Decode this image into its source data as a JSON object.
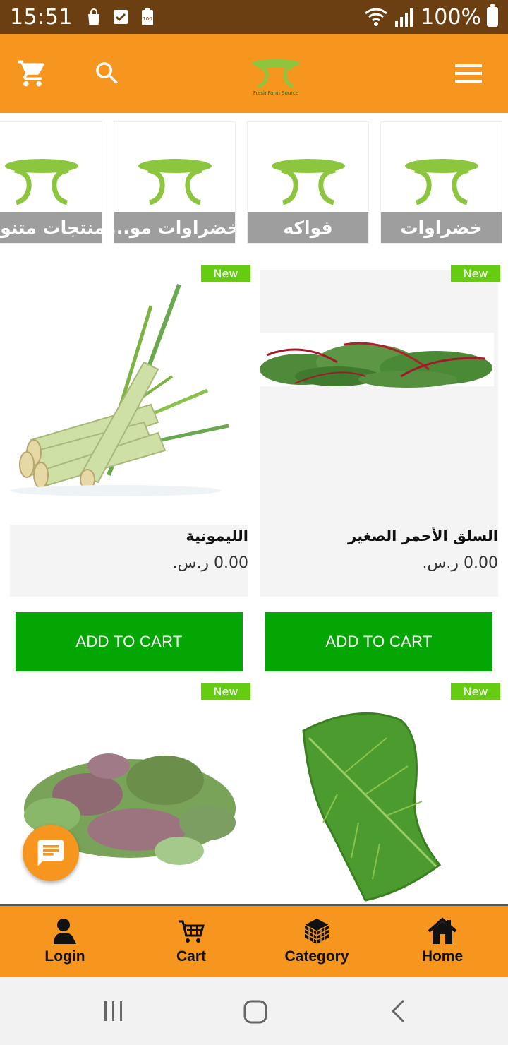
{
  "status_bar": {
    "time": "15:51",
    "battery": "100%"
  },
  "header": {
    "icons": [
      "cart-icon",
      "search-icon",
      "menu-icon"
    ],
    "logo_text": "Fresh Farm Source"
  },
  "categories": [
    {
      "label": "خضراوات"
    },
    {
      "label": "فواكه"
    },
    {
      "label": "خضراوات مو..."
    },
    {
      "label": "منتجات متنوعة"
    }
  ],
  "products": [
    {
      "badge": "New",
      "name": "السلق الأحمر الصغير",
      "price": "0.00 ر.س.",
      "button": "ADD TO CART"
    },
    {
      "badge": "New",
      "name": "الليمونية",
      "price": "0.00 ر.س.",
      "button": "ADD TO CART"
    },
    {
      "badge": "New",
      "name": "",
      "price": "",
      "button": ""
    },
    {
      "badge": "New",
      "name": "",
      "price": "",
      "button": ""
    }
  ],
  "bottom_nav": [
    {
      "label": "Login",
      "icon": "user-icon"
    },
    {
      "label": "Cart",
      "icon": "cart-icon"
    },
    {
      "label": "Category",
      "icon": "cube-icon"
    },
    {
      "label": "Home",
      "icon": "home-icon"
    }
  ],
  "colors": {
    "status_bar": "#6b3f12",
    "brand_orange": "#f7961e",
    "add_to_cart": "#04a603",
    "badge_green": "#66cc11",
    "category_label": "#9e9e9e"
  }
}
